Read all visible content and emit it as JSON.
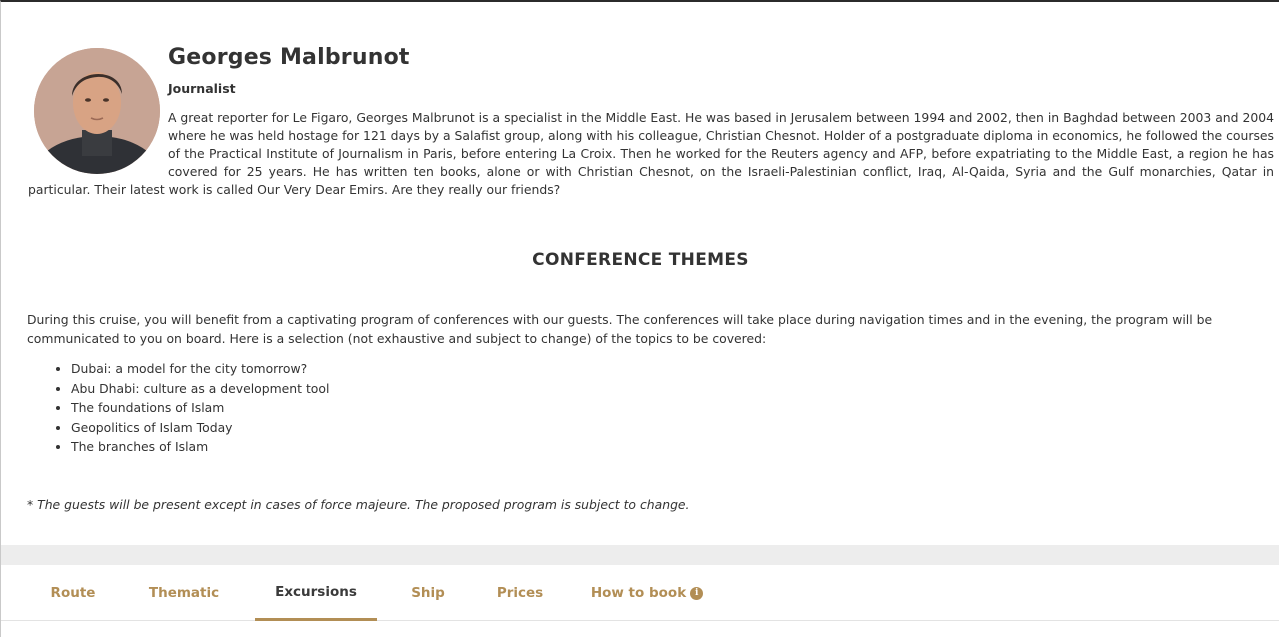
{
  "speaker": {
    "name": "Georges Malbrunot",
    "role": "Journalist",
    "bio": "A great reporter for Le Figaro, Georges Malbrunot is a specialist in the Middle East. He was based in Jerusalem between 1994 and 2002, then in Baghdad between 2003 and 2004 where he was held hostage for 121 days by a Salafist group, along with his colleague, Christian Chesnot. Holder of a postgraduate diploma in economics, he followed the courses of the Practical Institute of Journalism in Paris, before entering La Croix. Then he worked for the Reuters agency and AFP, before expatriating to the Middle East, a region he has covered for 25 years. He has written ten books, alone or with Christian Chesnot, on the Israeli-Palestinian conflict, Iraq, Al-Qaida, Syria and the Gulf monarchies, Qatar in particular. Their latest work is called Our Very Dear Emirs. Are they really our friends?"
  },
  "themes": {
    "title": "CONFERENCE THEMES",
    "intro": "During this cruise, you will benefit from a captivating program of conferences with our guests. The conferences will take place during navigation times and in the evening, the program will be communicated to you on board. Here is a selection (not exhaustive and subject to change) of the topics to be covered:",
    "topics": [
      "Dubai: a model for the city tomorrow?",
      "Abu Dhabi: culture as a development tool",
      "The foundations of Islam",
      "Geopolitics of Islam Today",
      "The branches of Islam"
    ],
    "disclaimer": "* The guests will be present except in cases of force majeure. The proposed program is subject to change."
  },
  "tabs": {
    "items": [
      {
        "label": "Route"
      },
      {
        "label": "Thematic"
      },
      {
        "label": "Excursions"
      },
      {
        "label": "Ship"
      },
      {
        "label": "Prices"
      },
      {
        "label": "How to book",
        "icon": "info-icon"
      }
    ],
    "active": "Excursions"
  },
  "colors": {
    "accent": "#b28e55",
    "text": "#333333",
    "band": "#ededed"
  }
}
